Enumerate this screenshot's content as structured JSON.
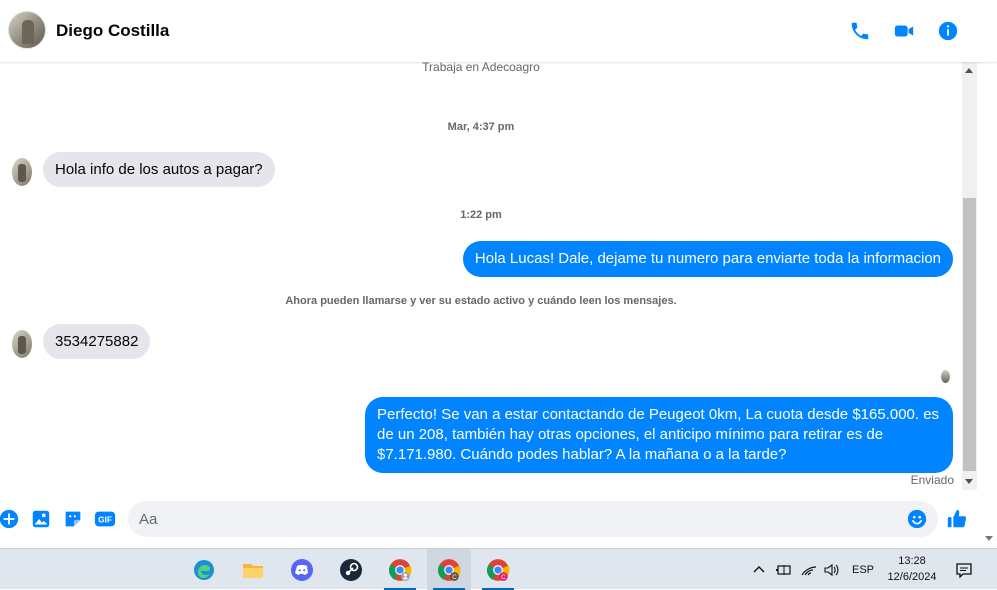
{
  "header": {
    "contact_name": "Diego Costilla",
    "icons": [
      "phone-icon",
      "video-icon",
      "info-icon"
    ],
    "accent_color": "#0084ff"
  },
  "conversation": {
    "work_info": "Trabaja en Adecoagro",
    "timestamp_1": "Mar, 4:37 pm",
    "msg_in_1": "Hola info de los autos a pagar?",
    "timestamp_2": "1:22 pm",
    "msg_out_1": "Hola Lucas! Dale, dejame tu numero para enviarte toda la informacion",
    "system_notice": "Ahora pueden llamarse y ver su estado activo y cuándo leen los mensajes.",
    "msg_in_2": "3534275882",
    "msg_out_2": "Perfecto!  Se van a estar contactando de Peugeot 0km, La cuota desde $165.000. es de un 208, también hay otras opciones, el anticipo mínimo para retirar es de $7.171.980. Cuándo podes hablar? A la mañana o a la tarde?",
    "status": "Enviado"
  },
  "composer": {
    "placeholder": "Aa",
    "icons": [
      "plus-icon",
      "image-icon",
      "sticker-icon",
      "gif-icon",
      "emoji-icon",
      "like-icon"
    ],
    "gif_label": "GIF"
  },
  "taskbar": {
    "apps": [
      "edge",
      "file-explorer",
      "discord",
      "steam",
      "chrome",
      "chrome-profile-c",
      "chrome-profile-c2"
    ],
    "language": "ESP",
    "time": "13:28",
    "date": "12/6/2024"
  }
}
